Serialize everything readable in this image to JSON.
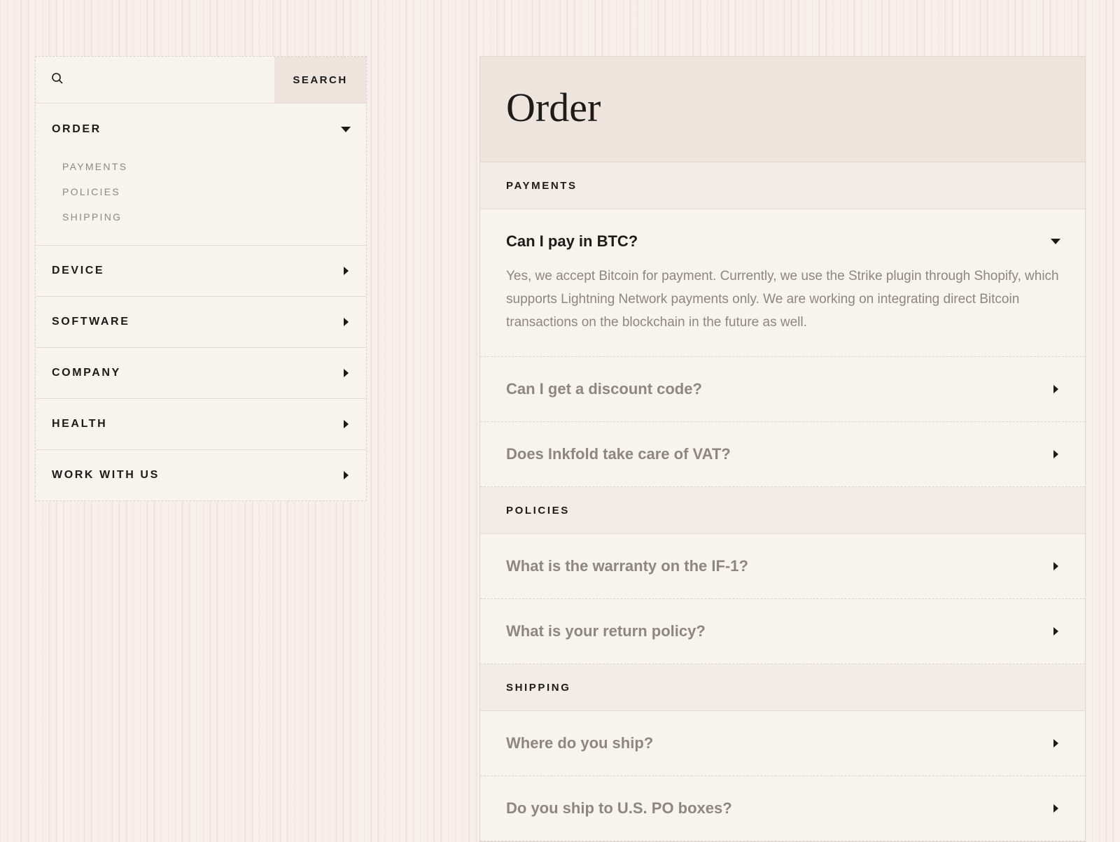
{
  "search": {
    "placeholder": "",
    "button_label": "SEARCH"
  },
  "sidebar": {
    "categories": [
      {
        "label": "ORDER",
        "expanded": true,
        "subitems": [
          "PAYMENTS",
          "POLICIES",
          "SHIPPING"
        ]
      },
      {
        "label": "DEVICE",
        "expanded": false
      },
      {
        "label": "SOFTWARE",
        "expanded": false
      },
      {
        "label": "COMPANY",
        "expanded": false
      },
      {
        "label": "HEALTH",
        "expanded": false
      },
      {
        "label": "WORK WITH US",
        "expanded": false
      }
    ]
  },
  "main": {
    "title": "Order",
    "sections": [
      {
        "label": "PAYMENTS",
        "faqs": [
          {
            "question": "Can I pay in BTC?",
            "expanded": true,
            "answer": "Yes, we accept Bitcoin for payment. Currently, we use the Strike plugin through Shopify, which supports Lightning Network payments only. We are working on integrating direct Bitcoin transactions on the blockchain in the future as well."
          },
          {
            "question": "Can I get a discount code?",
            "expanded": false
          },
          {
            "question": "Does Inkfold take care of VAT?",
            "expanded": false
          }
        ]
      },
      {
        "label": "POLICIES",
        "faqs": [
          {
            "question": "What is the warranty on the IF-1?",
            "expanded": false
          },
          {
            "question": "What is your return policy?",
            "expanded": false
          }
        ]
      },
      {
        "label": "SHIPPING",
        "faqs": [
          {
            "question": "Where do you ship?",
            "expanded": false
          },
          {
            "question": "Do you ship to U.S. PO boxes?",
            "expanded": false
          }
        ]
      }
    ]
  },
  "colors": {
    "background": "#f6efeb",
    "panel": "#f7f3ee",
    "header": "#ede4de",
    "text": "#1d1a17",
    "muted": "#8d8682"
  }
}
